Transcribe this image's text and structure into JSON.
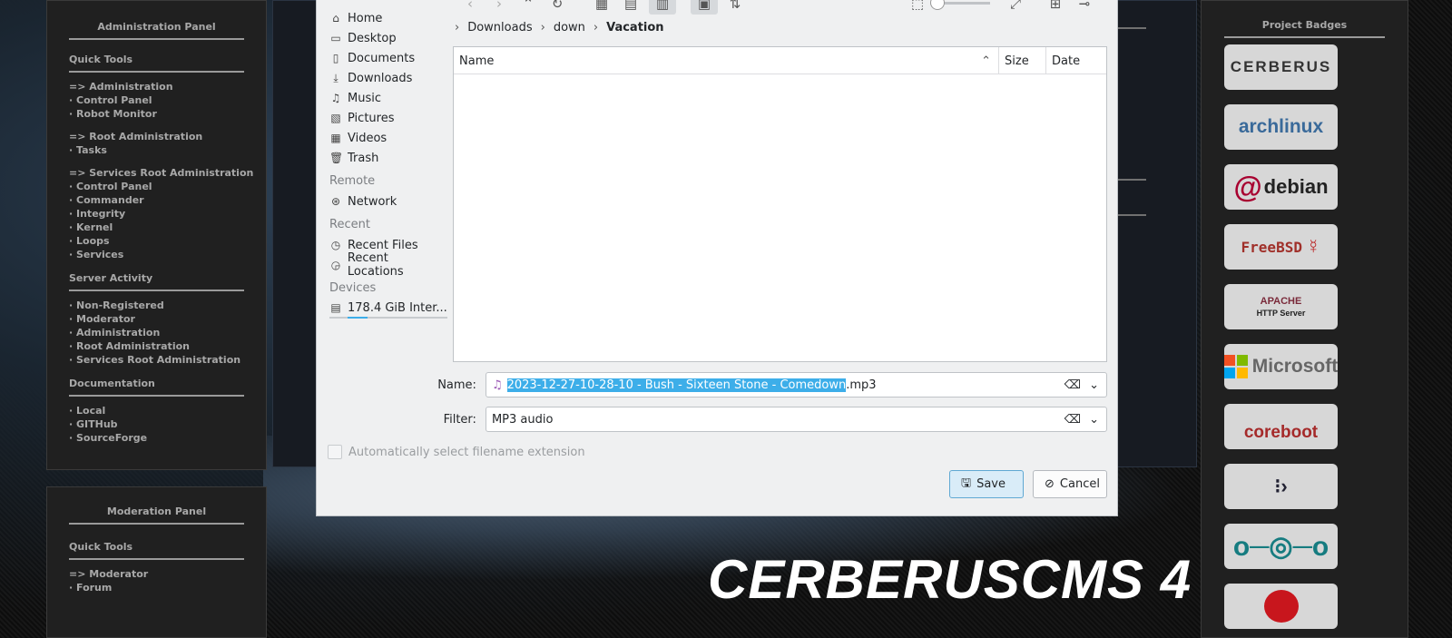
{
  "admin_panel": {
    "title": "Administration Panel",
    "quick_tools": "Quick Tools",
    "links": [
      "=> Administration",
      "· Control Panel",
      "· Robot Monitor",
      "=> Root Administration",
      "· Tasks",
      "=> Services Root Administration",
      "· Control Panel",
      "· Commander",
      "· Integrity",
      "· Kernel",
      "· Loops",
      "· Services"
    ],
    "server_activity": "Server Activity",
    "activity": [
      "· Non-Registered",
      "· Moderator",
      "· Administration",
      "· Root Administration",
      "· Services Root Administration"
    ],
    "documentation": "Documentation",
    "docs": [
      "· Local",
      "· GITHub",
      "· SourceForge"
    ]
  },
  "moderation_panel": {
    "title": "Moderation Panel",
    "quick_tools": "Quick Tools",
    "links": [
      "=> Moderator",
      "· Forum"
    ]
  },
  "project_badges": {
    "title": "Project Badges",
    "badges": [
      "CERBERUS",
      "archlinux",
      "debian",
      "FreeBSD",
      "APACHE",
      "Microsoft",
      "coreboot",
      "",
      "",
      ""
    ],
    "apache_sub": "HTTP Server"
  },
  "brand": "CERBERUSCMS 4",
  "dialog": {
    "places": {
      "items": [
        "Home",
        "Desktop",
        "Documents",
        "Downloads",
        "Music",
        "Pictures",
        "Videos",
        "Trash"
      ],
      "remote_header": "Remote",
      "remote": [
        "Network"
      ],
      "recent_header": "Recent",
      "recent": [
        "Recent Files",
        "Recent Locations"
      ],
      "devices_header": "Devices",
      "devices": [
        "178.4 GiB Inter..."
      ]
    },
    "breadcrumb": [
      "Downloads",
      "down",
      "Vacation"
    ],
    "columns": [
      "Name",
      "Size",
      "Date"
    ],
    "name_label": "Name:",
    "name_selected": "2023-12-27-10-28-10 - Bush - Sixteen Stone - Comedown",
    "name_suffix": ".mp3",
    "filter_label": "Filter:",
    "filter_value": "MP3 audio",
    "auto_ext": "Automatically select filename extension",
    "save": "Save",
    "cancel": "Cancel"
  }
}
